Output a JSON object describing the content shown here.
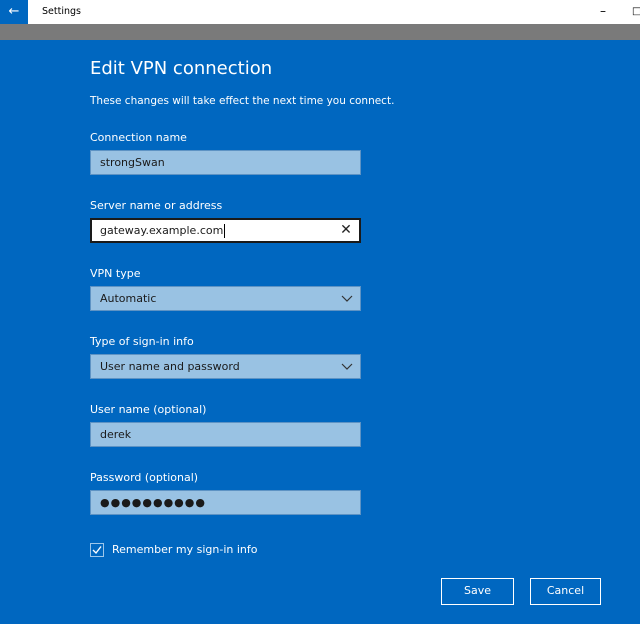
{
  "window": {
    "title": "Settings",
    "back_icon": "←",
    "minimize_icon": "–",
    "maximize_icon": "□"
  },
  "form": {
    "heading": "Edit VPN connection",
    "subtitle": "These changes will take effect the next time you connect.",
    "connection_name": {
      "label": "Connection name",
      "value": "strongSwan"
    },
    "server": {
      "label": "Server name or address",
      "value": "gateway.example.com",
      "clear_icon": "✕"
    },
    "vpn_type": {
      "label": "VPN type",
      "value": "Automatic"
    },
    "signin_type": {
      "label": "Type of sign-in info",
      "value": "User name and password"
    },
    "username": {
      "label": "User name (optional)",
      "value": "derek"
    },
    "password": {
      "label": "Password (optional)",
      "value": "●●●●●●●●●●"
    },
    "remember": {
      "label": "Remember my sign-in info",
      "checked": true
    }
  },
  "buttons": {
    "save": "Save",
    "cancel": "Cancel"
  },
  "colors": {
    "accent": "#0067c0",
    "field_bg": "#99c2e3",
    "titlebar_strip": "#7a7a7a"
  }
}
